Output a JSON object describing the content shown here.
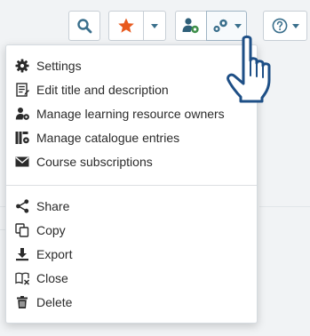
{
  "toolbar": {
    "search_icon": "search-icon",
    "favorite_icon": "star-icon",
    "owners_icon": "user-cog-icon",
    "tools_icon": "gears-icon",
    "help_icon": "help-circle-icon"
  },
  "menu": {
    "items": [
      {
        "label": "Settings",
        "icon": "gear-icon"
      },
      {
        "label": "Edit title and description",
        "icon": "edit-document-icon"
      },
      {
        "label": "Manage learning resource owners",
        "icon": "owners-icon"
      },
      {
        "label": "Manage catalogue entries",
        "icon": "catalogue-icon"
      },
      {
        "label": "Course subscriptions",
        "icon": "envelope-icon"
      },
      {
        "label": "Share",
        "icon": "share-icon"
      },
      {
        "label": "Copy",
        "icon": "copy-icon"
      },
      {
        "label": "Export",
        "icon": "download-icon"
      },
      {
        "label": "Close",
        "icon": "close-book-icon"
      },
      {
        "label": "Delete",
        "icon": "trash-icon"
      }
    ]
  },
  "colors": {
    "accent": "#3a6f8c",
    "star": "#e85a1e",
    "cog_green": "#3f8f4a",
    "text": "#2b2b2b",
    "cursor_outline": "#1e4f86"
  }
}
